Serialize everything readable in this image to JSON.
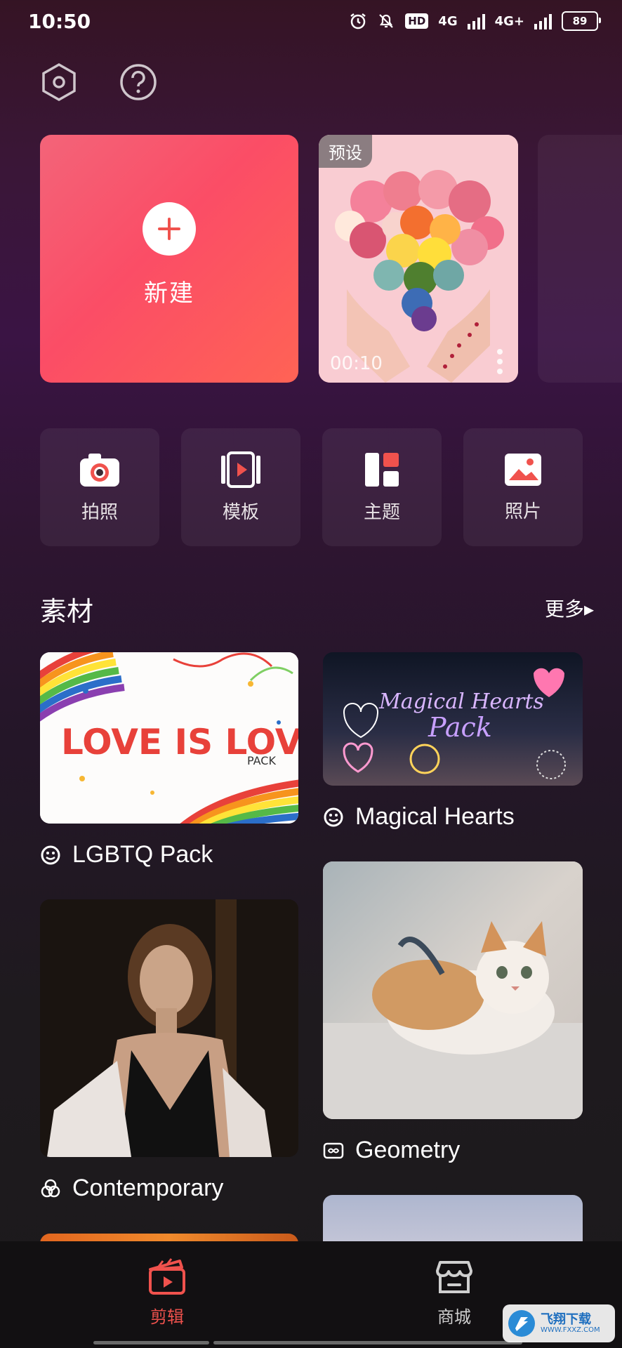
{
  "status_bar": {
    "time": "10:50",
    "hd": "HD",
    "net1": "4G",
    "net2": "4G+",
    "battery": "89"
  },
  "top_icons": [
    "settings-icon",
    "help-icon"
  ],
  "projects": {
    "new_label": "新建",
    "preset_tag": "预设",
    "preset_duration": "00:10"
  },
  "quick_actions": [
    {
      "label": "拍照",
      "icon": "camera-icon"
    },
    {
      "label": "模板",
      "icon": "template-icon"
    },
    {
      "label": "主题",
      "icon": "theme-icon"
    },
    {
      "label": "照片",
      "icon": "photo-icon"
    }
  ],
  "materials": {
    "title": "素材",
    "more": "更多▸",
    "items": [
      {
        "label": "LGBTQ Pack",
        "image_text": "LOVE IS LOVE",
        "image_subtext": "PACK"
      },
      {
        "label": "Magical Hearts",
        "image_text": "Magical Hearts",
        "image_subtext": "Pack"
      },
      {
        "label": "Contemporary"
      },
      {
        "label": "Geometry"
      }
    ]
  },
  "bottom_nav": {
    "items": [
      {
        "label": "剪辑",
        "active": true,
        "color": "#f0524d"
      },
      {
        "label": "商城",
        "active": false,
        "color": "#cfcfcf"
      }
    ]
  },
  "watermark": {
    "text": "飞翔下载",
    "sub": "WWW.FXXZ.COM"
  }
}
